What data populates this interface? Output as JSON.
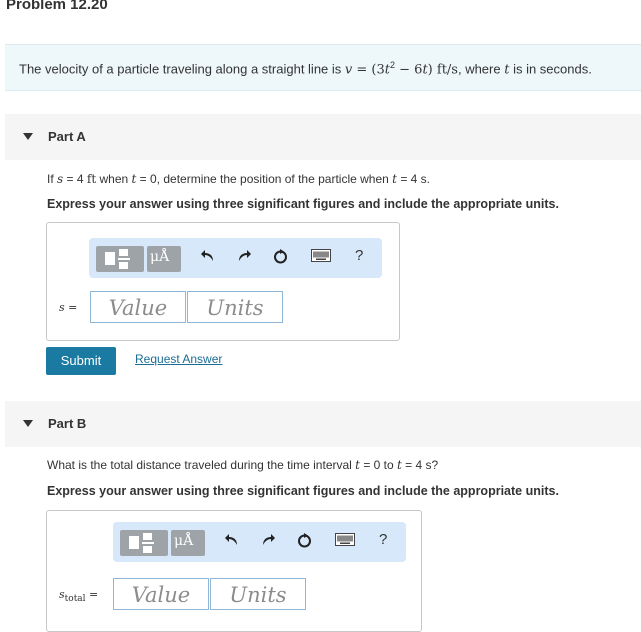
{
  "page_title": "Problem 12.20",
  "problem": {
    "prefix": "The velocity of a particle traveling along a straight line is ",
    "v": "v",
    "eq": " = (3",
    "t1": "t",
    "sq": "2",
    "minus": " − 6",
    "t2": "t",
    "unit": ") ft/s",
    "mid": ", where ",
    "t3": "t",
    "suffix": " is in seconds."
  },
  "partA": {
    "label": "Part A",
    "q_if": "If ",
    "q_s": "s",
    "q_eq1": " = 4 ",
    "q_ft": "ft",
    "q_when": " when ",
    "q_t1": "t",
    "q_zero": " = 0, determine the position of the particle when ",
    "q_t2": "t",
    "q_end": " = 4 s.",
    "instruction": "Express your answer using three significant figures and include the appropriate units.",
    "var_label": "s =",
    "value_placeholder": "Value",
    "units_placeholder": "Units",
    "submit": "Submit",
    "request": "Request Answer"
  },
  "partB": {
    "label": "Part B",
    "q_start": "What is the total distance traveled during the time interval ",
    "q_t1": "t",
    "q_mid": " = 0 to ",
    "q_t2": "t",
    "q_end": " = 4 s?",
    "instruction": "Express your answer using three significant figures and include the appropriate units.",
    "var_base": "s",
    "var_sub": "total",
    "var_eq": " =",
    "value_placeholder": "Value",
    "units_placeholder": "Units"
  },
  "toolbar": {
    "mu": "μÅ",
    "help": "?",
    "icons": [
      "templates-icon",
      "units-icon",
      "undo-icon",
      "redo-icon",
      "reset-icon",
      "keyboard-icon",
      "help-icon"
    ]
  },
  "colors": {
    "problem_bg": "#eef8fb",
    "toolbar_bg": "#d6e8f9",
    "submit_bg": "#1a7aa1",
    "link": "#1a6d95"
  }
}
